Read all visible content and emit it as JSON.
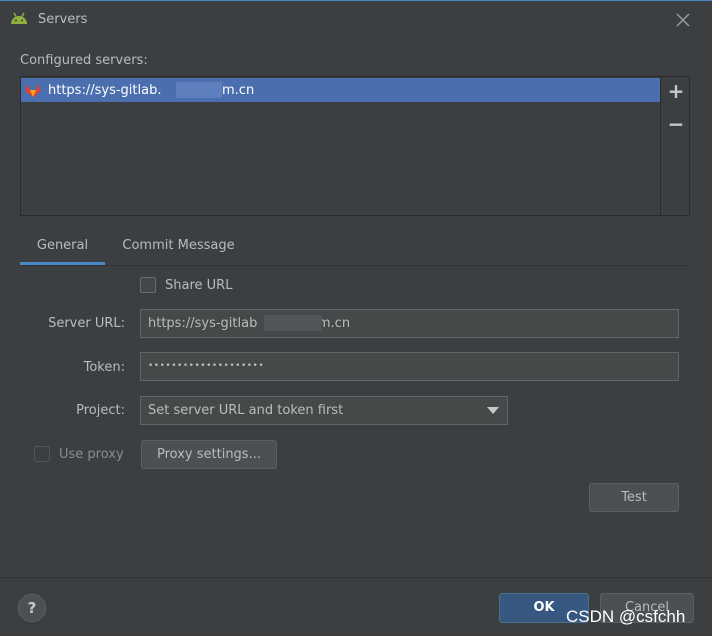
{
  "window": {
    "title": "Servers",
    "icon": "android-icon",
    "close_icon": "close-icon"
  },
  "servers": {
    "section_label": "Configured servers:",
    "items": [
      {
        "url": "https://sys-gitlab.          .com.cn",
        "icon": "gitlab-icon",
        "selected": true
      }
    ],
    "add_label": "+",
    "remove_label": "−"
  },
  "tabs": [
    {
      "label": "General",
      "active": true
    },
    {
      "label": "Commit Message",
      "active": false
    }
  ],
  "form": {
    "share_url_label": "Share URL",
    "share_url_checked": false,
    "server_url_label": "Server URL:",
    "server_url_value": "https://sys-gitlab          .com.cn",
    "token_label": "Token:",
    "token_value": "••••••••••••••••••••",
    "project_label": "Project:",
    "project_value": "Set server URL and token first",
    "use_proxy_label": "Use proxy",
    "use_proxy_checked": false,
    "proxy_settings_label": "Proxy settings...",
    "test_label": "Test"
  },
  "footer": {
    "help_label": "?",
    "ok_label": "OK",
    "cancel_label": "Cancel"
  },
  "watermark": "CSDN @csfchh",
  "colors": {
    "background": "#3c3f41",
    "selection": "#4b6eaf",
    "accent_underline": "#4a88c7",
    "ok_button": "#365880"
  }
}
